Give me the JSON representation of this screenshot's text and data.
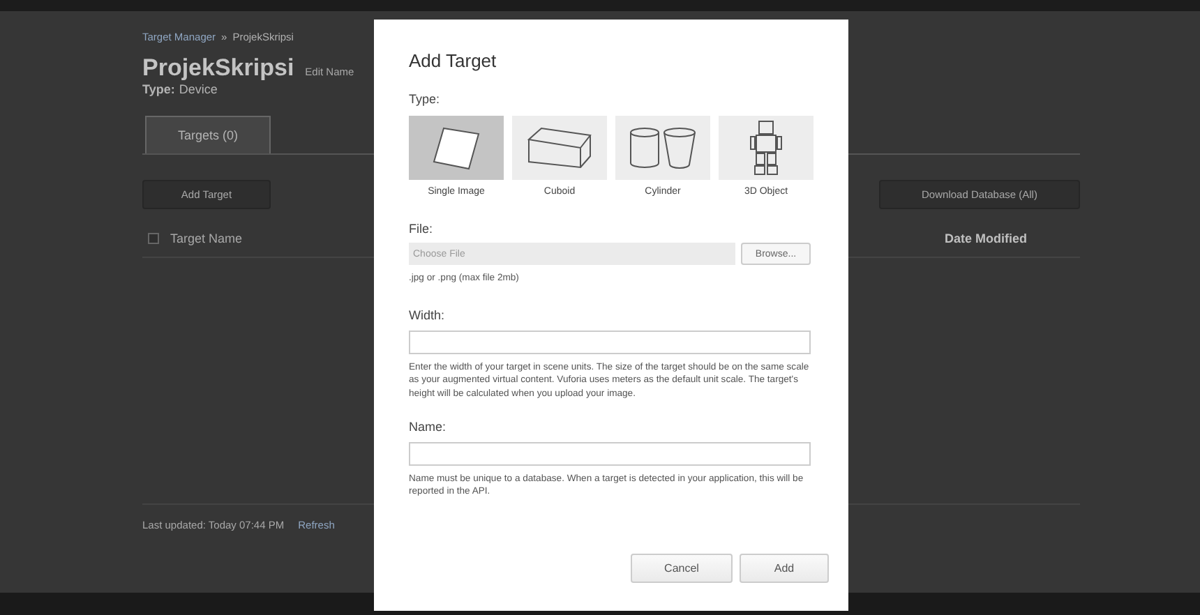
{
  "page": {
    "breadcrumb": [
      {
        "label": "Target Manager",
        "link": true
      },
      {
        "label": "ProjekSkripsi",
        "link": false
      }
    ],
    "breadcrumb_separator": "»",
    "title": "ProjekSkripsi",
    "edit_link": "Edit Name",
    "type_label": "Type:",
    "type_value": "Device",
    "tabs": [
      {
        "label": "Targets (0)",
        "selected": true
      }
    ],
    "add_button": "Add Target",
    "download_button": "Download Database (All)",
    "select_all_checked": false,
    "columns": [
      "Target Name",
      "Date Modified"
    ],
    "last_updated": "Last updated: Today 07:44 PM",
    "refresh": "Refresh"
  },
  "dialog": {
    "title": "Add Target",
    "type_label": "Type:",
    "types": [
      {
        "kind": "image",
        "label": "Single Image",
        "selected": true
      },
      {
        "kind": "cuboid",
        "label": "Cuboid",
        "selected": false
      },
      {
        "kind": "cylinder",
        "label": "Cylinder",
        "selected": false
      },
      {
        "kind": "object",
        "label": "3D Object",
        "selected": false
      }
    ],
    "file_label": "File:",
    "file_placeholder": "Choose File",
    "browse": "Browse...",
    "file_hint": ".jpg or .png (max file 2mb)",
    "width_label": "Width:",
    "width_hint": "Enter the width of your target in scene units. The size of the target should be on the same scale as your augmented virtual content. Vuforia uses meters as the default unit scale. The target's height will be calculated when you upload your image.",
    "name_label": "Name:",
    "name_hint": "Name must be unique to a database. When a target is detected in your application, this will be reported in the API.",
    "buttons": [
      "Cancel",
      "Add"
    ]
  }
}
